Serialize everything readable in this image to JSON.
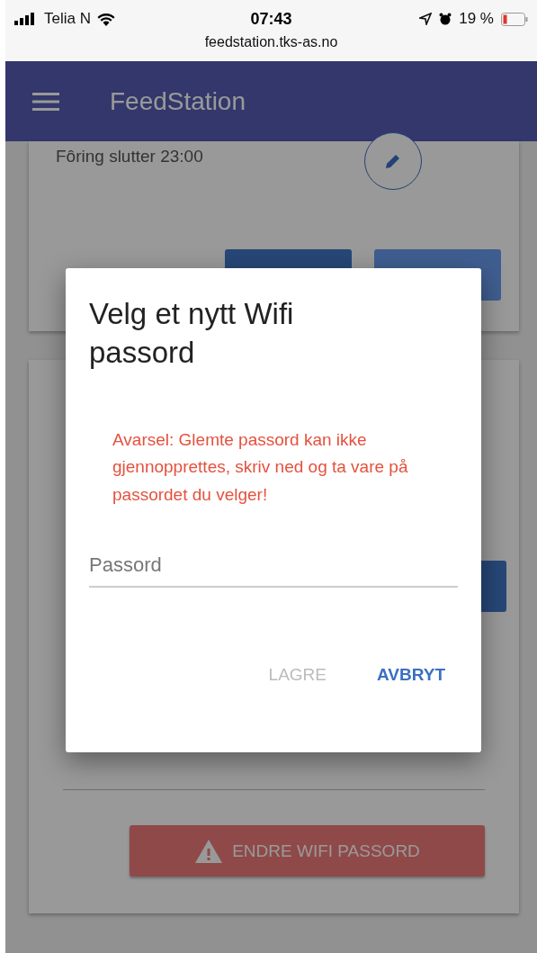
{
  "status_bar": {
    "carrier": "Telia N",
    "time": "07:43",
    "battery": "19 %",
    "url": "feedstation.tks-as.no"
  },
  "app_bar": {
    "title": "FeedStation"
  },
  "feeding_card": {
    "end_time": "Fôring slutter 23:00"
  },
  "wifi_card": {
    "button": "ENDRE WIFI PASSORD"
  },
  "dialog": {
    "title": "Velg et nytt Wifi passord",
    "warning": "Avarsel: Glemte passord kan ikke gjennopprettes, skriv ned og ta vare på passordet du velger!",
    "field": {
      "placeholder": "Passord"
    },
    "actions": [
      {
        "label": "LAGRE",
        "disabled": true
      },
      {
        "label": "AVBRYT",
        "disabled": false
      }
    ]
  }
}
